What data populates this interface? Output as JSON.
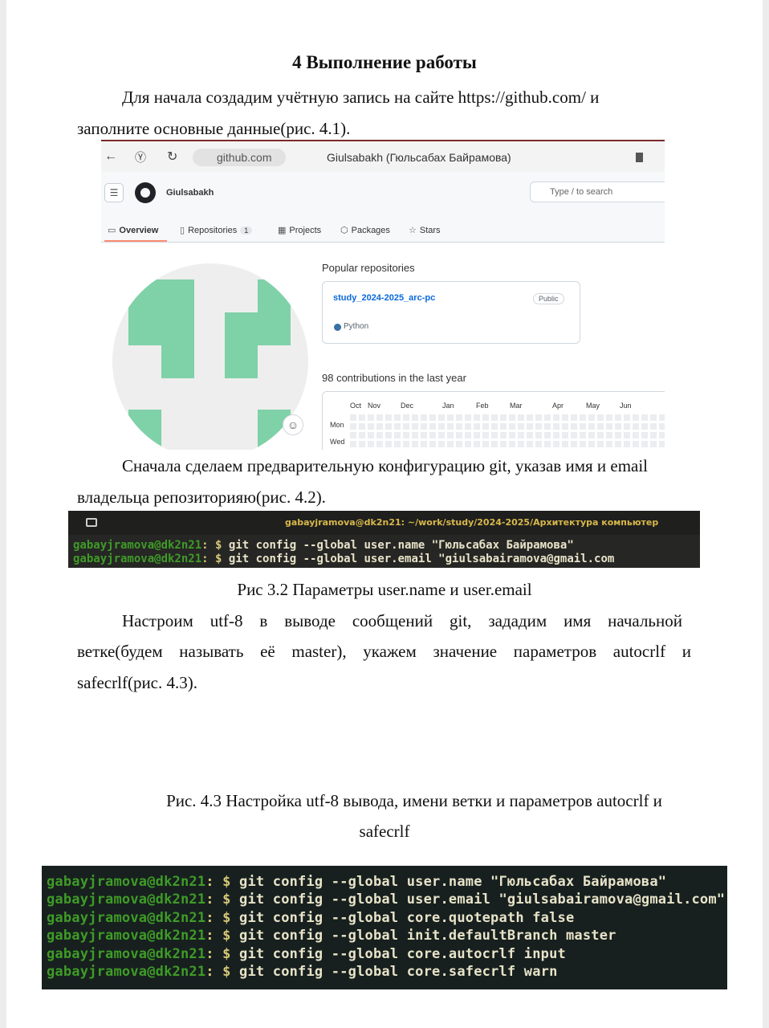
{
  "heading": "4 Выполнение работы",
  "para1": {
    "line1": "Для начала создадим учётную запись на сайте https://github.com/ и",
    "line2": "заполните основные данные(рис. 4.1)."
  },
  "github": {
    "url": "github.com",
    "tab_title": "Giulsabakh (Гюльсабах Байрамова)",
    "username": "Giulsabakh",
    "search_placeholder": "Type / to search",
    "tabs": [
      {
        "label": "Overview"
      },
      {
        "label": "Repositories",
        "count": "1"
      },
      {
        "label": "Projects"
      },
      {
        "label": "Packages"
      },
      {
        "label": "Stars"
      }
    ],
    "popular_title": "Popular repositories",
    "repo_name": "study_2024-2025_arc-pc",
    "repo_visibility": "Public",
    "repo_language": "Python",
    "contributions": "98 contributions in the last year",
    "months": [
      "Oct",
      "Nov",
      "Dec",
      "Jan",
      "Feb",
      "Mar",
      "Apr",
      "May",
      "Jun"
    ],
    "days": [
      "Mon",
      "Wed"
    ]
  },
  "para2": {
    "line1": "Сначала сделаем предварительную конфигурацию git, указав имя и email",
    "line2": "владельца репозиторияю(рис. 4.2)."
  },
  "term1": {
    "title": "gabayjramova@dk2n21: ~/work/study/2024-2025/Архитектура компьютер",
    "prompt_user": "gabayjramova@dk2n21",
    "prompt_sep": ": $",
    "lines": [
      "git config --global user.name \"Гюльсабах Байрамова\"",
      "git config --global user.email \"giulsabairamova@gmail.com"
    ]
  },
  "caption2": "Рис 3.2 Параметры user.name и user.email",
  "para3": {
    "line1": [
      "Настроим",
      "utf-8",
      "в",
      "выводе",
      "сообщений",
      "git,",
      "зададим",
      "имя",
      "начальной"
    ],
    "line2": [
      "ветке(будем",
      "называть",
      "её",
      "master),",
      "укажем",
      "значение",
      "параметров",
      "autocrlf",
      "и"
    ],
    "line3": "safecrlf(рис. 4.3)."
  },
  "caption3": {
    "line1": "Рис. 4.3 Настройка utf-8 вывода, имени ветки и параметров autocrlf и",
    "line2": "safecrlf"
  },
  "term2": {
    "prompt_user": "gabayjramova@dk2n21",
    "prompt_sep": ": $",
    "lines": [
      "git config --global user.name \"Гюльсабах Байрамова\"",
      "git config --global user.email \"giulsabairamova@gmail.com\"",
      "git config --global core.quotepath false",
      "git config --global init.defaultBranch master",
      "git config --global core.autocrlf input",
      "git config --global core.safecrlf warn"
    ]
  }
}
